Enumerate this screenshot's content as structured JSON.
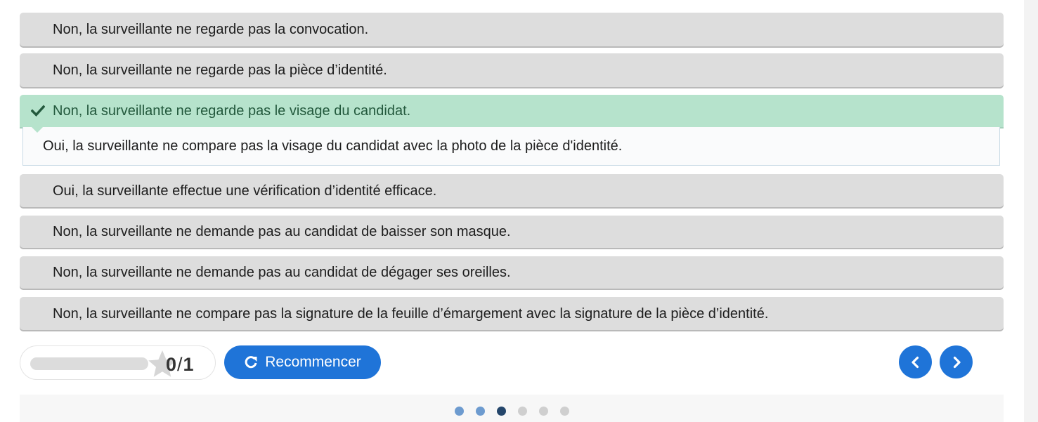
{
  "alternatives": [
    {
      "label": "Non, la surveillante ne regarde pas la convocation.",
      "state": "neutral"
    },
    {
      "label": "Non, la surveillante ne regarde pas la pièce d’identité.",
      "state": "neutral"
    },
    {
      "label": "Non, la surveillante ne regarde pas le visage du candidat.",
      "state": "correct"
    },
    {
      "label": "Oui, la surveillante effectue une vérification d’identité efficace.",
      "state": "neutral"
    },
    {
      "label": "Non, la surveillante ne demande pas au candidat de baisser son masque.",
      "state": "neutral"
    },
    {
      "label": "Non, la surveillante ne demande pas au candidat de dégager ses oreilles.",
      "state": "neutral"
    },
    {
      "label": "Non, la surveillante ne compare pas la signature de la feuille d’émargement avec la signature de la pièce d’identité.",
      "state": "neutral"
    }
  ],
  "feedback": {
    "text": "Oui, la surveillante ne compare pas la visage du candidat avec la photo de la pièce d'identité."
  },
  "score": {
    "current": "0",
    "separator": "/",
    "max": "1",
    "progress_fraction": 0,
    "star_icon": "star-icon"
  },
  "retry_button": {
    "label": "Recommencer",
    "icon": "retry-icon"
  },
  "navigation": {
    "prev_icon": "chevron-left-icon",
    "next_icon": "chevron-right-icon"
  },
  "pagination": {
    "total": 6,
    "current_index": 2,
    "visited": [
      0,
      1
    ]
  },
  "colors": {
    "accent": "#1f74d8",
    "correct_bg": "#b6e3cc",
    "correct_text": "#23593d",
    "neutral_bg": "#dddddd",
    "dot_visited": "#6d9bcf",
    "dot_current": "#24466b",
    "dot_inactive": "#cfcfcf"
  }
}
